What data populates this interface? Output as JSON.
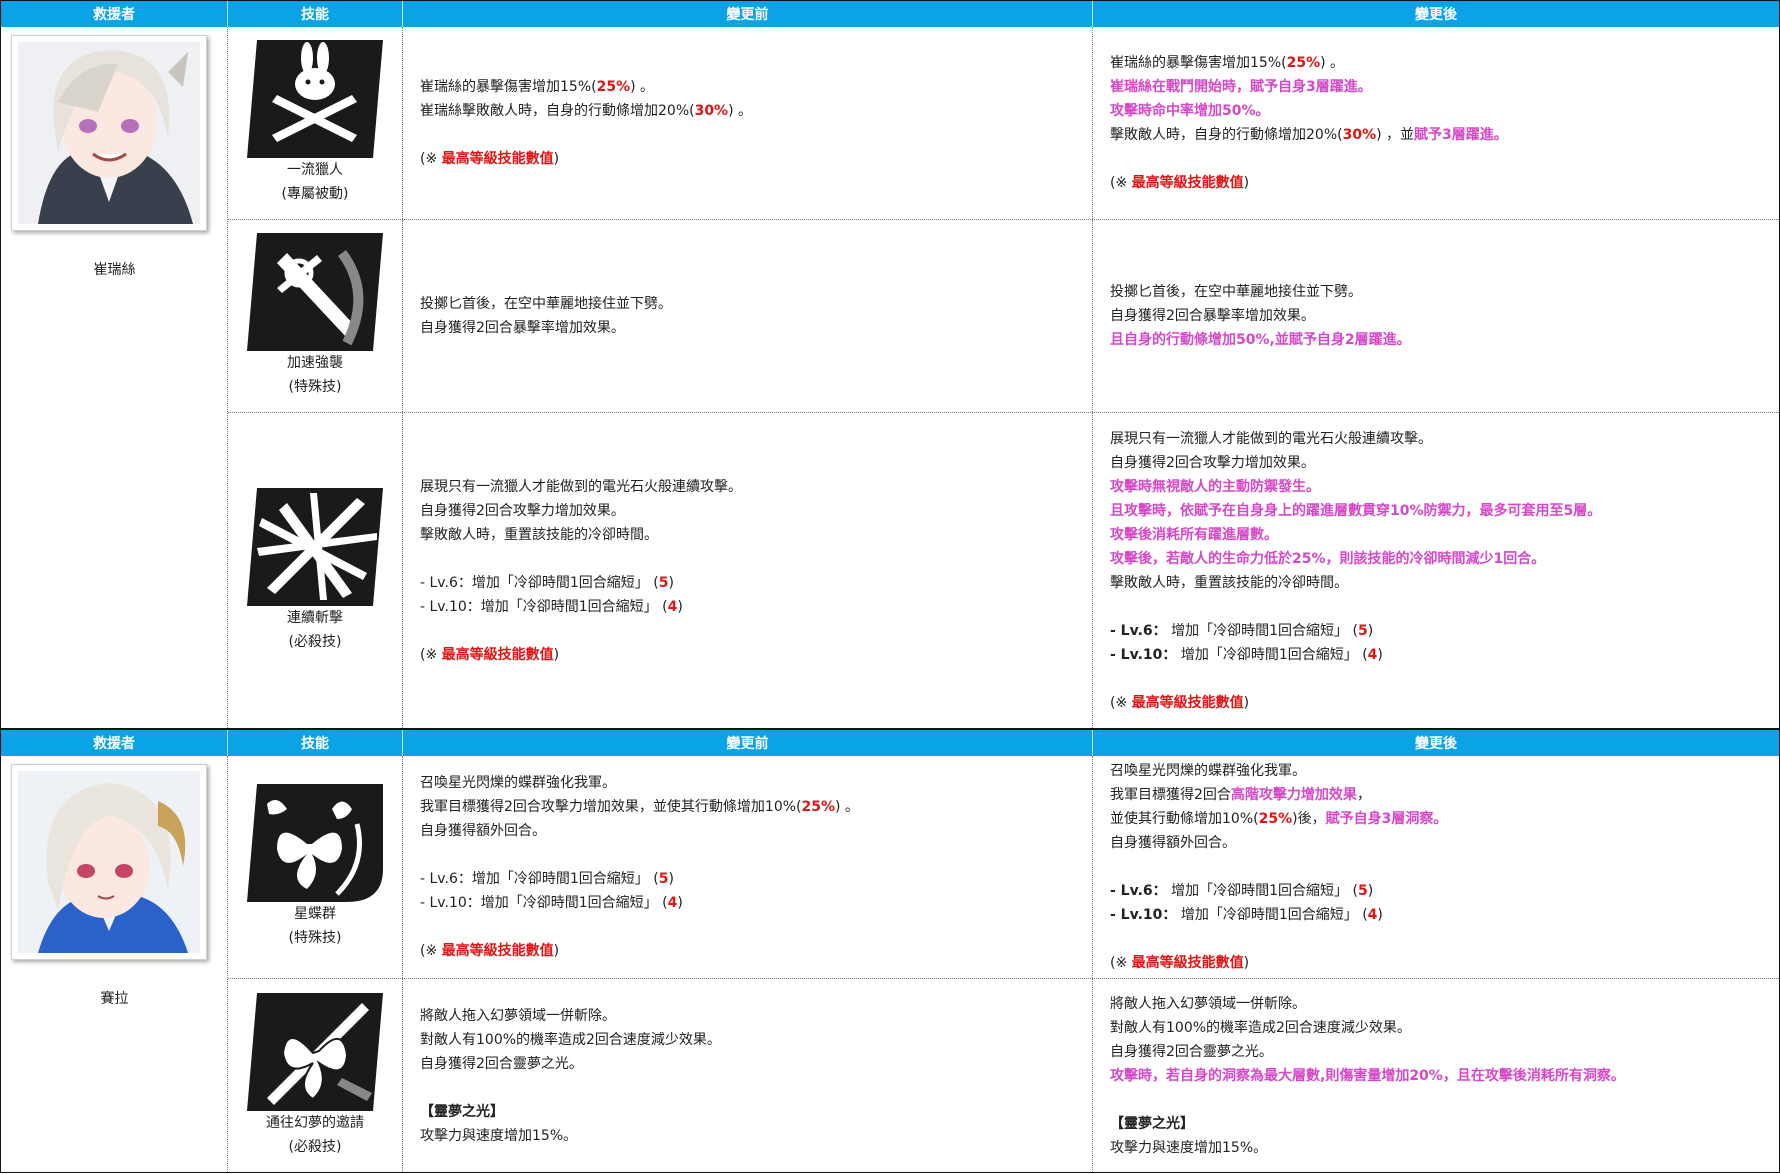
{
  "header": {
    "rescuer": "救援者",
    "skill": "技能",
    "before": "變更前",
    "after": "變更後"
  },
  "characters": [
    {
      "name": "崔瑞絲",
      "skills": [
        {
          "name": "一流獵人",
          "type": "(專屬被動)",
          "icon": "bunny-crossed-knives-icon",
          "before": [
            [
              {
                "t": "崔瑞絲的暴擊傷害增加15%("
              },
              {
                "t": "25%",
                "s": "r"
              },
              {
                "t": ") 。"
              }
            ],
            [
              {
                "t": "崔瑞絲擊敗敵人時，自身的行動條增加20%("
              },
              {
                "t": "30%",
                "s": "r"
              },
              {
                "t": ") 。"
              }
            ],
            [],
            [
              {
                "t": "(※ "
              },
              {
                "t": "最高等級技能數值",
                "s": "r"
              },
              {
                "t": ")"
              }
            ]
          ],
          "after": [
            [
              {
                "t": "崔瑞絲的暴擊傷害增加15%("
              },
              {
                "t": "25%",
                "s": "r"
              },
              {
                "t": ") 。"
              }
            ],
            [
              {
                "t": "崔瑞絲在戰鬥開始時，賦予自身3層躍進。",
                "s": "p"
              }
            ],
            [
              {
                "t": "攻擊時命中率增加50%。",
                "s": "p"
              }
            ],
            [
              {
                "t": "擊敗敵人時，自身的行動條增加20%("
              },
              {
                "t": "30%",
                "s": "r"
              },
              {
                "t": ") ，並"
              },
              {
                "t": "賦予3層躍進。",
                "s": "p"
              }
            ],
            [],
            [
              {
                "t": "(※ "
              },
              {
                "t": "最高等級技能數值",
                "s": "r"
              },
              {
                "t": ")"
              }
            ]
          ]
        },
        {
          "name": "加速強襲",
          "type": "(特殊技)",
          "icon": "thrown-dagger-icon",
          "before": [
            [
              {
                "t": "投擲匕首後，在空中華麗地接住並下劈。"
              }
            ],
            [
              {
                "t": "自身獲得2回合暴擊率增加效果。"
              }
            ]
          ],
          "after": [
            [
              {
                "t": "投擲匕首後，在空中華麗地接住並下劈。"
              }
            ],
            [
              {
                "t": "自身獲得2回合暴擊率增加效果。"
              }
            ],
            [
              {
                "t": "且自身的行動條增加50%,並賦予自身2層躍進。",
                "s": "p"
              }
            ]
          ]
        },
        {
          "name": "連續斬擊",
          "type": "(必殺技)",
          "icon": "slash-flurry-icon",
          "before": [
            [
              {
                "t": "展現只有一流獵人才能做到的電光石火般連續攻擊。"
              }
            ],
            [
              {
                "t": "自身獲得2回合攻擊力增加效果。"
              }
            ],
            [
              {
                "t": "擊敗敵人時，重置該技能的冷卻時間。"
              }
            ],
            [],
            [
              {
                "t": "- Lv.6：增加「冷卻時間1回合縮短」 ("
              },
              {
                "t": "5",
                "s": "r"
              },
              {
                "t": ")"
              }
            ],
            [
              {
                "t": "- Lv.10：增加「冷卻時間1回合縮短」 ("
              },
              {
                "t": "4",
                "s": "r"
              },
              {
                "t": ")"
              }
            ],
            [],
            [
              {
                "t": "(※ "
              },
              {
                "t": "最高等級技能數值",
                "s": "r"
              },
              {
                "t": ")"
              }
            ]
          ],
          "after": [
            [
              {
                "t": "展現只有一流獵人才能做到的電光石火般連續攻擊。"
              }
            ],
            [
              {
                "t": "自身獲得2回合攻擊力增加效果。"
              }
            ],
            [
              {
                "t": "攻擊時無視敵人的主動防禦發生。",
                "s": "p"
              }
            ],
            [
              {
                "t": "且攻擊時，依賦予在自身身上的躍進層數貫穿10%防禦力，最多可套用至5層。",
                "s": "p"
              }
            ],
            [
              {
                "t": "攻擊後消耗所有躍進層數。",
                "s": "p"
              }
            ],
            [
              {
                "t": "攻擊後，若敵人的生命力低於25%，則該技能的冷卻時間減少1回合。",
                "s": "p"
              }
            ],
            [
              {
                "t": "擊敗敵人時，重置該技能的冷卻時間。"
              }
            ],
            [],
            [
              {
                "t": "- Lv.6：",
                "s": "b"
              },
              {
                "t": " 增加「冷卻時間1回合縮短」 ("
              },
              {
                "t": "5",
                "s": "r"
              },
              {
                "t": ")"
              }
            ],
            [
              {
                "t": "- Lv.10：",
                "s": "b"
              },
              {
                "t": " 增加「冷卻時間1回合縮短」 ("
              },
              {
                "t": "4",
                "s": "r"
              },
              {
                "t": ")"
              }
            ],
            [],
            [
              {
                "t": "(※ "
              },
              {
                "t": "最高等級技能數值",
                "s": "r"
              },
              {
                "t": ")"
              }
            ]
          ]
        }
      ]
    },
    {
      "name": "賽拉",
      "skills": [
        {
          "name": "星蝶群",
          "type": "(特殊技)",
          "icon": "butterfly-swarm-icon",
          "before": [
            [
              {
                "t": "召喚星光閃爍的蝶群強化我軍。"
              }
            ],
            [
              {
                "t": "我軍目標獲得2回合攻擊力增加效果，並使其行動條增加10%("
              },
              {
                "t": "25%",
                "s": "r"
              },
              {
                "t": ") 。"
              }
            ],
            [
              {
                "t": "自身獲得額外回合。"
              }
            ],
            [],
            [
              {
                "t": "- Lv.6：增加「冷卻時間1回合縮短」 ("
              },
              {
                "t": "5",
                "s": "r"
              },
              {
                "t": ")"
              }
            ],
            [
              {
                "t": "- Lv.10：增加「冷卻時間1回合縮短」 ("
              },
              {
                "t": "4",
                "s": "r"
              },
              {
                "t": ")"
              }
            ],
            [],
            [
              {
                "t": "(※ "
              },
              {
                "t": "最高等級技能數值",
                "s": "r"
              },
              {
                "t": ")"
              }
            ]
          ],
          "after": [
            [
              {
                "t": "召喚星光閃爍的蝶群強化我軍。"
              }
            ],
            [
              {
                "t": "我軍目標獲得2回合"
              },
              {
                "t": "高階攻擊力增加效果",
                "s": "p"
              },
              {
                "t": "，"
              }
            ],
            [
              {
                "t": "並使其行動條增加10%("
              },
              {
                "t": "25%",
                "s": "r"
              },
              {
                "t": ")後，"
              },
              {
                "t": "賦予自身3層洞察。",
                "s": "p"
              }
            ],
            [
              {
                "t": "自身獲得額外回合。"
              }
            ],
            [],
            [
              {
                "t": "- Lv.6：",
                "s": "b"
              },
              {
                "t": " 增加「冷卻時間1回合縮短」 ("
              },
              {
                "t": "5",
                "s": "r"
              },
              {
                "t": ")"
              }
            ],
            [
              {
                "t": "- Lv.10：",
                "s": "b"
              },
              {
                "t": " 增加「冷卻時間1回合縮短」 ("
              },
              {
                "t": "4",
                "s": "r"
              },
              {
                "t": ")"
              }
            ],
            [],
            [
              {
                "t": "(※ "
              },
              {
                "t": "最高等級技能數值",
                "s": "r"
              },
              {
                "t": ")"
              }
            ]
          ]
        },
        {
          "name": "通往幻夢的邀請",
          "type": "(必殺技)",
          "icon": "dream-butterfly-blade-icon",
          "before": [
            [
              {
                "t": "將敵人拖入幻夢領域一併斬除。"
              }
            ],
            [
              {
                "t": "對敵人有100%的機率造成2回合速度減少效果。"
              }
            ],
            [
              {
                "t": "自身獲得2回合靈夢之光。"
              }
            ],
            [],
            [
              {
                "t": "【靈夢之光】",
                "s": "b"
              }
            ],
            [
              {
                "t": "攻擊力與速度增加15%。"
              }
            ]
          ],
          "after": [
            [
              {
                "t": "將敵人拖入幻夢領域一併斬除。"
              }
            ],
            [
              {
                "t": "對敵人有100%的機率造成2回合速度減少效果。"
              }
            ],
            [
              {
                "t": "自身獲得2回合靈夢之光。"
              }
            ],
            [
              {
                "t": "攻擊時，若自身的洞察為最大層數,則傷害量增加20%，且在攻擊後消耗所有洞察。",
                "s": "p"
              }
            ],
            [],
            [
              {
                "t": "【靈夢之光】",
                "s": "b"
              }
            ],
            [
              {
                "t": "攻擊力與速度增加15%。"
              }
            ]
          ]
        }
      ]
    }
  ]
}
